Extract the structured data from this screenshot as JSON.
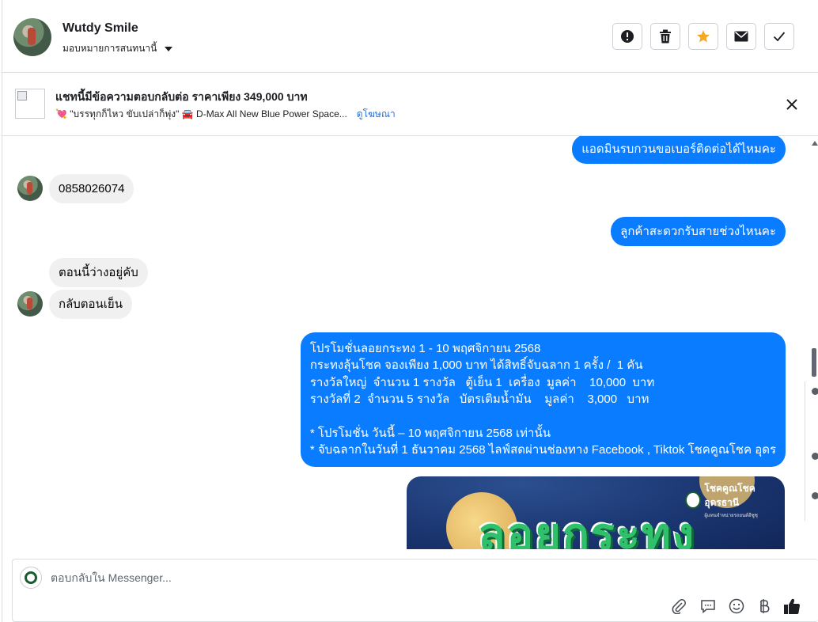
{
  "header": {
    "contact_name": "Wutdy Smile",
    "assign_label": "มอบหมายการสนทนานี้",
    "actions": [
      {
        "name": "mark-spam",
        "icon": "exclamation-circle-icon"
      },
      {
        "name": "delete",
        "icon": "trash-icon"
      },
      {
        "name": "star",
        "icon": "star-icon",
        "color": "#f5a623"
      },
      {
        "name": "mark-unread",
        "icon": "envelope-icon"
      },
      {
        "name": "mark-done",
        "icon": "checkmark-icon"
      }
    ]
  },
  "ad": {
    "title": "แชทนี้มีข้อความตอบกลับต่อ ราคาเพียง 349,000 บาท",
    "subtitle": "💘 \"บรรทุกก็ไหว ขับเปล่าก็พุ่ง\" 🚘 D-Max All New Blue Power Space...",
    "link_label": "ดูโฆษณา"
  },
  "messages": [
    {
      "direction": "out",
      "text": "แอดมินรบกวนขอเบอร์ติดต่อได้ไหมคะ"
    },
    {
      "direction": "in",
      "text": "0858026074"
    },
    {
      "direction": "out",
      "text": "ลูกค้าสะดวกรับสายช่วงไหนคะ"
    },
    {
      "direction": "in",
      "text": "ตอนนี้ว่างอยู่คับ"
    },
    {
      "direction": "in",
      "text": "กลับตอนเย็น"
    },
    {
      "direction": "out",
      "text": "โปรโมชั่นลอยกระทง 1 - 10 พฤศจิกายน 2568\nกระทงลุ้นโชค จองเพียง 1,000 บาท ได้สิทธิ์จับฉลาก 1 ครั้ง /  1 คัน\nรางวัลใหญ่  จำนวน 1 รางวัล   ตู้เย็น 1  เครื่อง  มูลค่า    10,000  บาท\nรางวัลที่ 2  จำนวน 5 รางวัล   บัตรเติมน้ำมัน    มูลค่า    3,000   บาท\n\n* โปรโมชั่น วันนี้ – 10 พฤศจิกายน 2568 เท่านั้น\n* จับฉลากในวันที่ 1 ธันวาคม 2568 ไลฟ์สดผ่านช่องทาง Facebook , Tiktok โชคคูณโชค อุดร"
    }
  ],
  "promo_image": {
    "headline": "ลอยกระทง",
    "brand_name": "โชคคูณโชค อุดรธานี",
    "brand_tagline": "ผู้แทนจำหน่ายรถยนต์อีซูซุ"
  },
  "composer": {
    "placeholder": "ตอบกลับใน Messenger...",
    "tools": [
      "paperclip-icon",
      "saved-reply-icon",
      "emoji-icon",
      "baht-payment-icon",
      "thumbs-up-icon"
    ]
  },
  "colors": {
    "outgoing_bubble": "#0a7cff",
    "incoming_bubble": "#f0f0f0",
    "link": "#216fdb"
  }
}
